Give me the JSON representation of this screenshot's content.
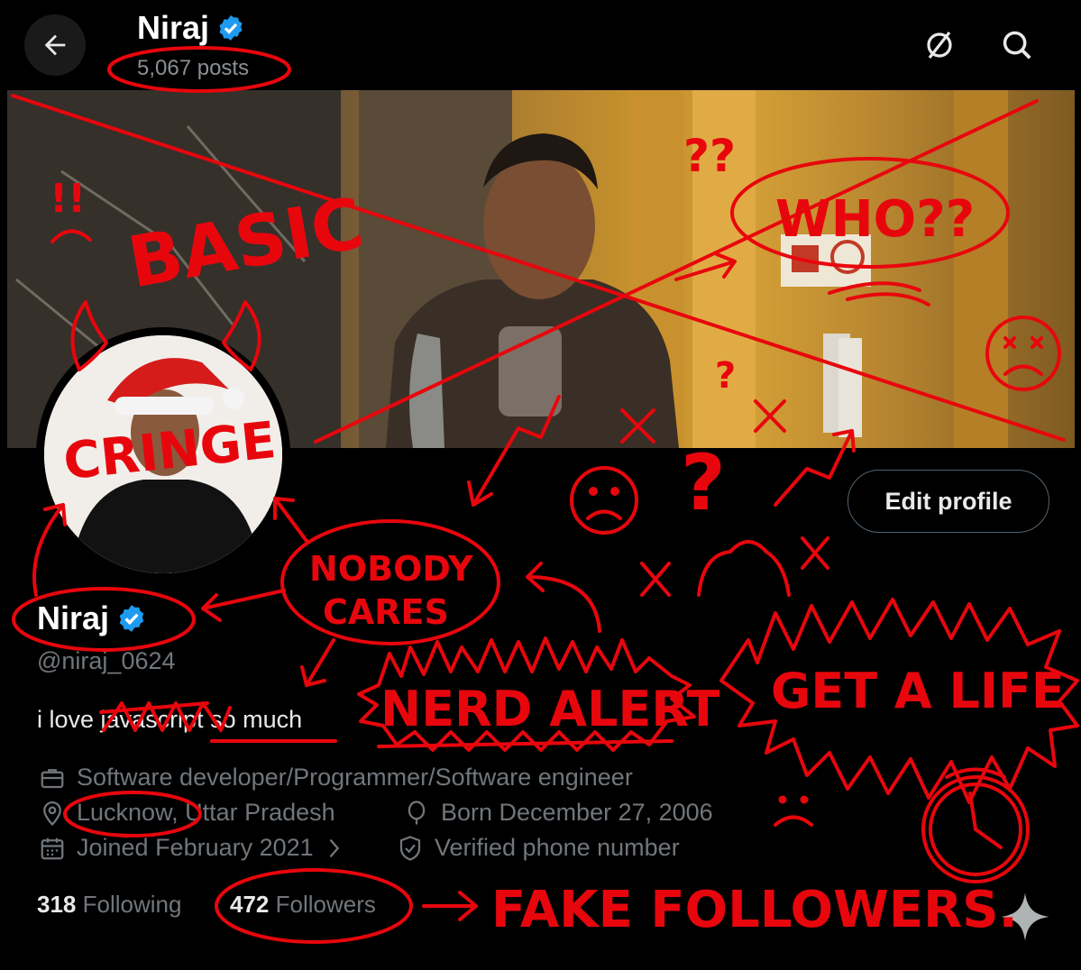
{
  "header": {
    "name": "Niraj",
    "posts": "5,067 posts",
    "back_icon": "arrow-left-icon",
    "icons": [
      "grok-icon",
      "search-icon"
    ]
  },
  "profile": {
    "name": "Niraj",
    "handle": "@niraj_0624",
    "bio": "i love javascript so much",
    "edit_label": "Edit profile",
    "verified_color": "#1d9bf0",
    "meta": {
      "profession": "Software developer/Programmer/Software engineer",
      "location": "Lucknow, Uttar Pradesh",
      "birthday": "Born December 27, 2006",
      "joined": "Joined February 2021",
      "phone": "Verified phone number"
    },
    "following_count": "318",
    "following_label": "Following",
    "followers_count": "472",
    "followers_label": "Followers"
  },
  "annotations": {
    "color": "#e8060d",
    "basic": "BASIC",
    "exclaim": "!!",
    "who": "WHO??",
    "question_big": "??",
    "cringe": "CRINGE",
    "nobody": "NOBODY",
    "cares": "CARES",
    "nerd_alert": "NERD ALERT",
    "get_a_life": "GET A LIFE",
    "fake_followers": "FAKE FOLLOWERS."
  }
}
